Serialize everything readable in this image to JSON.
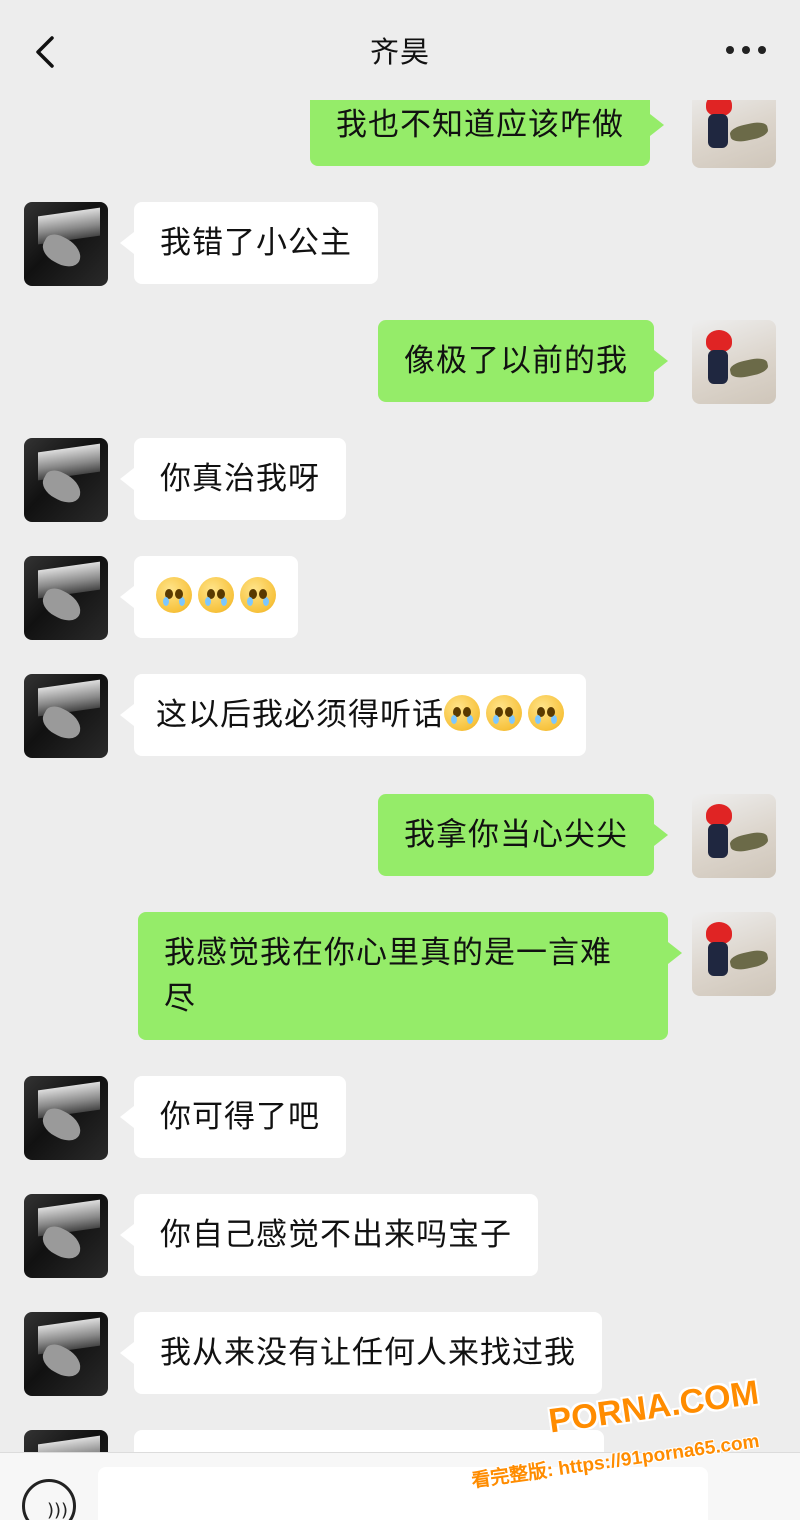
{
  "header": {
    "title": "齐昊",
    "back_icon": "chevron-left-icon",
    "more_icon": "more-dots-icon"
  },
  "messages": [
    {
      "side": "out",
      "text": "我也不知道应该咋做"
    },
    {
      "side": "in",
      "text": "我错了小公主"
    },
    {
      "side": "out",
      "text": "像极了以前的我"
    },
    {
      "side": "in",
      "text": "你真治我呀"
    },
    {
      "side": "in",
      "text": "",
      "emoji_count": 3,
      "emoji": "crying-face"
    },
    {
      "side": "in",
      "text": "这以后我必须得听话",
      "emoji_count": 3,
      "emoji": "crying-face"
    },
    {
      "side": "out",
      "text": "我拿你当心尖尖"
    },
    {
      "side": "out",
      "text": "我感觉我在你心里真的是一言难尽"
    },
    {
      "side": "in",
      "text": "你可得了吧"
    },
    {
      "side": "in",
      "text": "你自己感觉不出来吗宝子"
    },
    {
      "side": "in",
      "text": "我从来没有让任何人来找过我"
    }
  ],
  "input": {
    "voice_icon": "voice-icon",
    "placeholder": ""
  },
  "watermark": {
    "brand": "PORNA.COM",
    "line": "看完整版: https://91porna65.com"
  },
  "colors": {
    "background": "#ededed",
    "outgoing_bubble": "#95ec69",
    "incoming_bubble": "#ffffff",
    "watermark": "#ff8c00"
  }
}
